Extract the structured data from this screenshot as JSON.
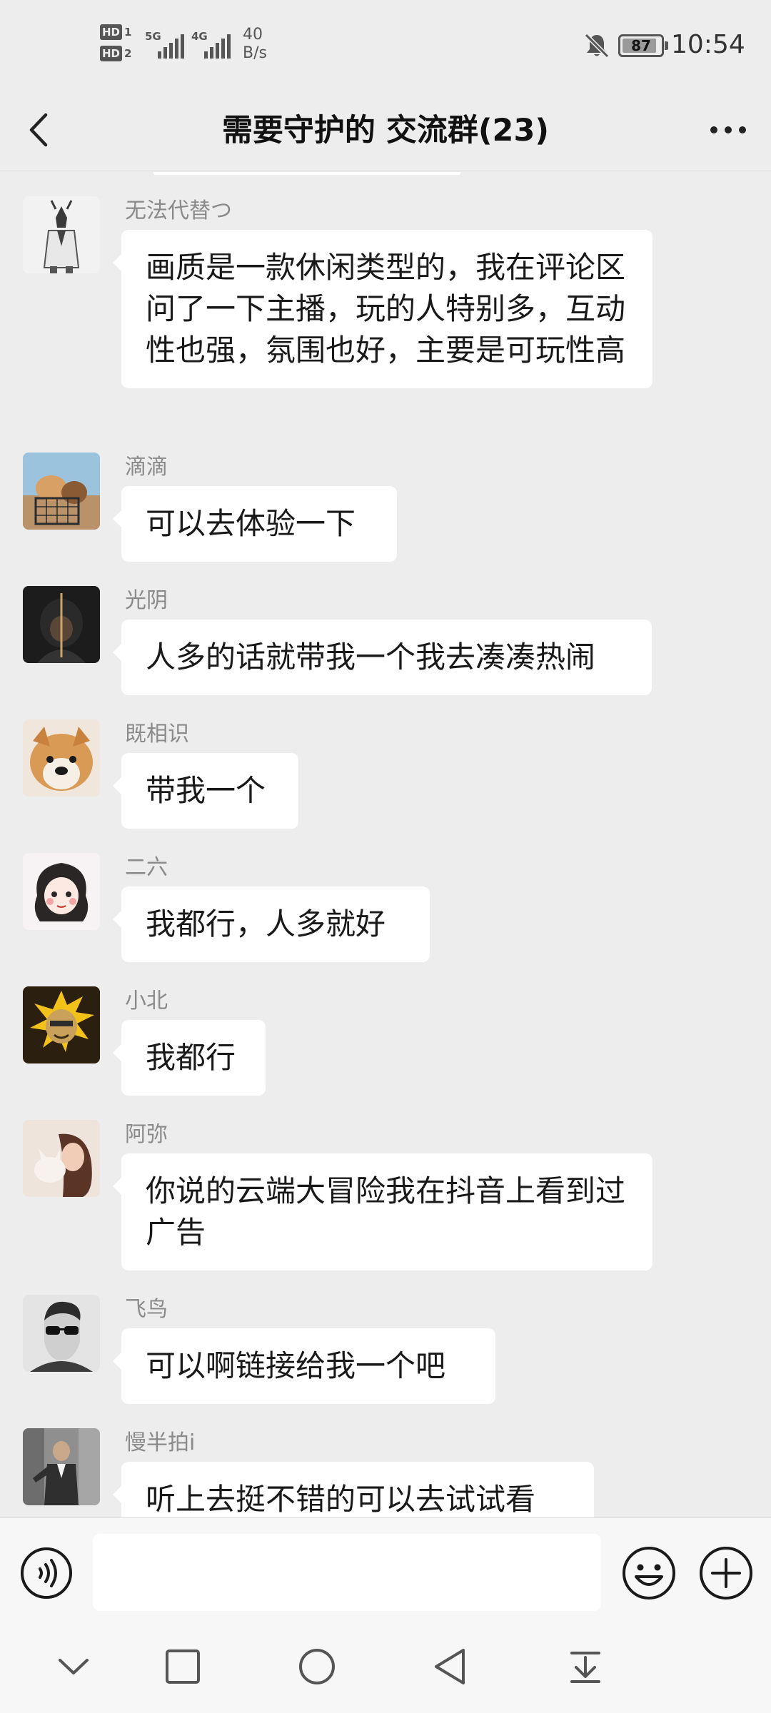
{
  "status_bar": {
    "hd1": "HD",
    "sim1": "1",
    "hd2": "HD",
    "sim2": "2",
    "net1": "5G",
    "net2": "4G",
    "speed_value": "40",
    "speed_unit": "B/s",
    "battery": "87",
    "time": "10:54",
    "icons": [
      "bell-muted-icon",
      "battery-icon"
    ]
  },
  "header": {
    "title": "需要守护的 交流群(23)",
    "back_icon": "chevron-left-icon",
    "more_icon": "more-dots-icon"
  },
  "messages": [
    {
      "sender": "无法代替つ",
      "text": "画质是一款休闲类型的，我在评论区问了一下主播，玩的人特别多，互动性也强，氛围也好，主要是可玩性高"
    },
    {
      "sender": "滴滴",
      "text": "可以去体验一下"
    },
    {
      "sender": "光阴",
      "text": "人多的话就带我一个我去凑凑热闹"
    },
    {
      "sender": "既相识",
      "text": "带我一个"
    },
    {
      "sender": "二六",
      "text": "我都行，人多就好"
    },
    {
      "sender": "小北",
      "text": "我都行"
    },
    {
      "sender": "阿弥",
      "text": "你说的云端大冒险我在抖音上看到过广告"
    },
    {
      "sender": "飞鸟",
      "text": "可以啊链接给我一个吧"
    },
    {
      "sender": "慢半拍i",
      "text": "听上去挺不错的可以去试试看"
    }
  ],
  "input_bar": {
    "value": "",
    "icons": [
      "voice-icon",
      "emoji-icon",
      "plus-icon"
    ]
  },
  "nav_bar": {
    "icons": [
      "chevron-down-icon",
      "recents-square-icon",
      "home-circle-icon",
      "back-triangle-icon",
      "notification-pull-icon"
    ]
  }
}
